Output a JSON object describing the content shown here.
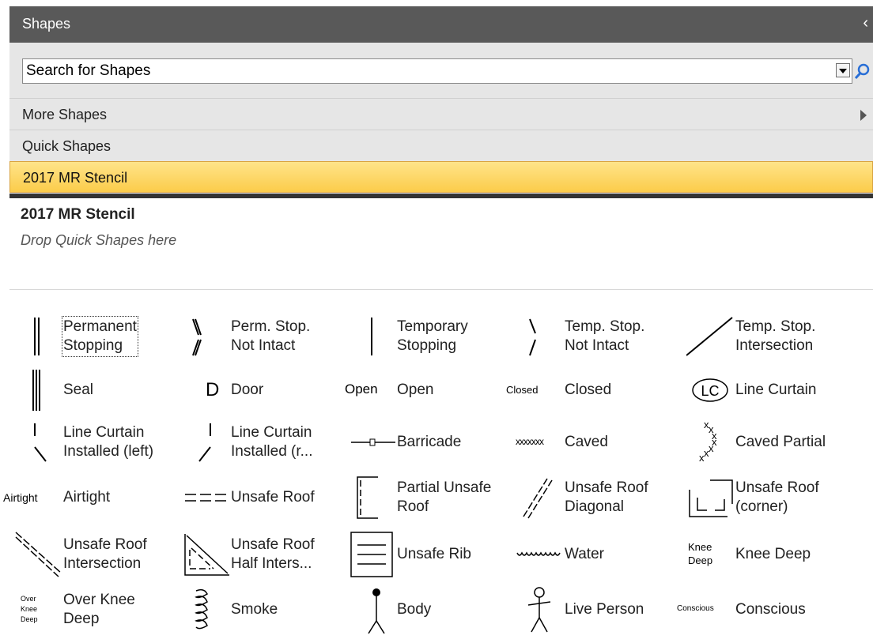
{
  "panel": {
    "title": "Shapes",
    "collapse_glyph": "‹",
    "search_placeholder": "Search for Shapes",
    "more_shapes": "More Shapes",
    "quick_shapes": "Quick Shapes",
    "selected_stencil": "2017 MR Stencil",
    "stencil_title": "2017 MR Stencil",
    "stencil_hint": "Drop Quick Shapes here"
  },
  "shapes": [
    {
      "label": "Permanent\nStopping",
      "icon": "permanent-stopping-icon"
    },
    {
      "label": "Perm. Stop.\nNot Intact",
      "icon": "perm-stop-not-intact-icon"
    },
    {
      "label": "Temporary\nStopping",
      "icon": "temporary-stopping-icon"
    },
    {
      "label": "Temp. Stop.\nNot Intact",
      "icon": "temp-stop-not-intact-icon"
    },
    {
      "label": "Temp. Stop.\nIntersection",
      "icon": "temp-stop-intersection-icon"
    },
    {
      "label": "Seal",
      "icon": "seal-icon"
    },
    {
      "label": "Door",
      "icon": "door-icon",
      "icon_text": "D"
    },
    {
      "label": "Open",
      "icon": "open-icon",
      "icon_text": "Open"
    },
    {
      "label": "Closed",
      "icon": "closed-icon",
      "icon_text": "Closed"
    },
    {
      "label": "Line Curtain",
      "icon": "line-curtain-icon",
      "icon_text": "LC"
    },
    {
      "label": "Line Curtain\nInstalled (left)",
      "icon": "line-curtain-left-icon"
    },
    {
      "label": "Line Curtain\nInstalled (r...",
      "icon": "line-curtain-right-icon"
    },
    {
      "label": "Barricade",
      "icon": "barricade-icon"
    },
    {
      "label": "Caved",
      "icon": "caved-icon",
      "icon_text": "xxxxxxx"
    },
    {
      "label": "Caved Partial",
      "icon": "caved-partial-icon"
    },
    {
      "label": "Airtight",
      "icon": "airtight-icon",
      "icon_text": "Airtight"
    },
    {
      "label": "Unsafe Roof",
      "icon": "unsafe-roof-icon"
    },
    {
      "label": "Partial Unsafe\nRoof",
      "icon": "partial-unsafe-roof-icon"
    },
    {
      "label": "Unsafe Roof\nDiagonal",
      "icon": "unsafe-roof-diagonal-icon"
    },
    {
      "label": "Unsafe Roof\n(corner)",
      "icon": "unsafe-roof-corner-icon"
    },
    {
      "label": "Unsafe Roof\nIntersection",
      "icon": "unsafe-roof-intersection-icon"
    },
    {
      "label": "Unsafe Roof\nHalf Inters...",
      "icon": "unsafe-roof-half-intersection-icon"
    },
    {
      "label": "Unsafe Rib",
      "icon": "unsafe-rib-icon"
    },
    {
      "label": "Water",
      "icon": "water-icon"
    },
    {
      "label": "Knee Deep",
      "icon": "knee-deep-icon",
      "icon_text": "Knee\nDeep"
    },
    {
      "label": "Over Knee\nDeep",
      "icon": "over-knee-deep-icon",
      "icon_text": "Over\nKnee\nDeep"
    },
    {
      "label": "Smoke",
      "icon": "smoke-icon"
    },
    {
      "label": "Body",
      "icon": "body-icon"
    },
    {
      "label": "Live Person",
      "icon": "live-person-icon"
    },
    {
      "label": "Conscious",
      "icon": "conscious-icon",
      "icon_text": "Conscious"
    }
  ]
}
